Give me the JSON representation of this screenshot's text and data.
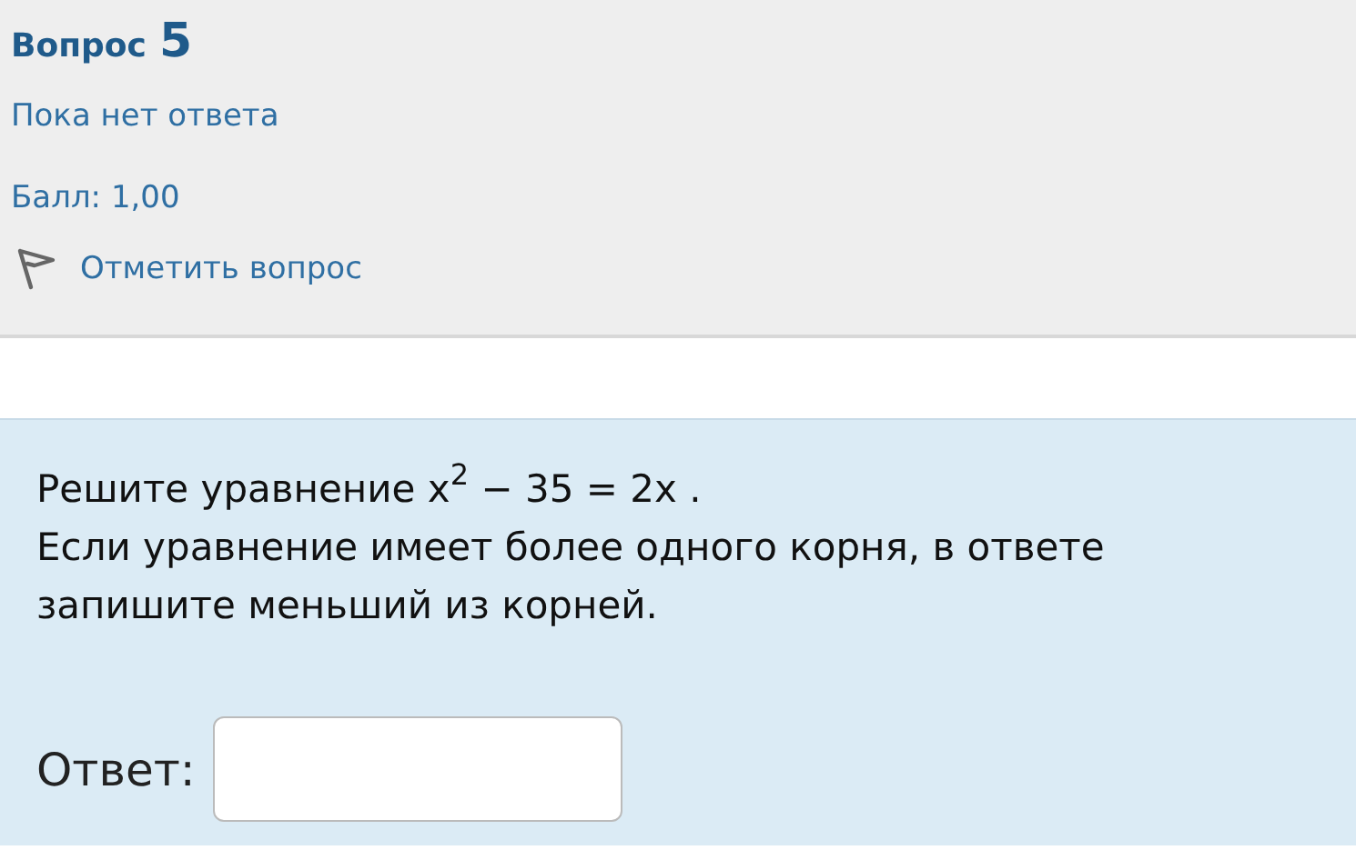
{
  "info": {
    "label": "Вопрос",
    "number": "5",
    "status": "Пока нет ответа",
    "grade": "Балл: 1,00",
    "flag_label": "Отметить вопрос"
  },
  "content": {
    "paragraphs": [
      "Решите уравнение x$^{2}$ − 35 = 2x .",
      "Если уравнение имеет более одного корня, в ответе запишите меньший из корней."
    ],
    "answer": {
      "label": "Ответ:"
    }
  }
}
